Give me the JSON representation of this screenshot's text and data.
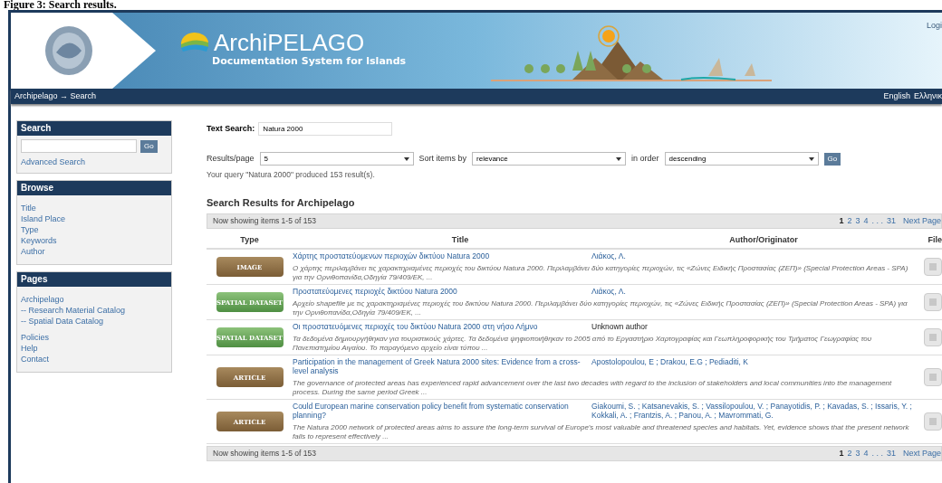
{
  "caption": "Figure 3: Search results.",
  "header": {
    "logo_title": "ArchiPELAGO",
    "subtitle": "Documentation System for Islands",
    "login": "Logi"
  },
  "breadcrumb": "Archipelago → Search",
  "languages": [
    "English",
    "Ελληνικ"
  ],
  "sidebar": {
    "search": {
      "title": "Search",
      "go": "Go",
      "link": "Advanced Search"
    },
    "browse": {
      "title": "Browse",
      "items": [
        "Title",
        "Island Place",
        "Type",
        "Keywords",
        "Author"
      ]
    },
    "pages": {
      "title": "Pages",
      "groups": [
        [
          "Archipelago",
          "-- Research Material Catalog",
          "-- Spatial Data Catalog"
        ],
        [
          "Policies",
          "Help",
          "Contact"
        ]
      ]
    }
  },
  "text_search": {
    "label": "Text Search:",
    "value": "Natura 2000"
  },
  "controls": [
    {
      "label": "Results/page",
      "value": "5"
    },
    {
      "label": "Sort items by",
      "value": "relevance"
    },
    {
      "label": "in order",
      "value": "descending"
    }
  ],
  "go": "Go",
  "summary": "Your query \"Natura 2000\" produced 153 result(s).",
  "heading": "Search Results for Archipelago",
  "pager_top": {
    "text": "Now showing items 1-5 of 153",
    "pages": [
      {
        "label": "1",
        "selected": true
      },
      {
        "label": "2",
        "selected": false
      },
      {
        "label": "3",
        "selected": false
      },
      {
        "label": "4",
        "selected": false
      },
      {
        "label": ". . .",
        "selected": false
      },
      {
        "label": "31",
        "selected": false
      }
    ],
    "next": "Next Page"
  },
  "columns": [
    "Type",
    "Title",
    "Author/Originator",
    "File"
  ],
  "rows": [
    {
      "kind": "image",
      "badge": "IMAGE",
      "title": "Χάρτης προστατεύομενων περιοχών δικτύου Natura 2000",
      "author": "Λιάκος, Λ.",
      "author_link": true,
      "description": "Ο χάρτης περιλαμβάνει τις χαρακτηρισμένες περιοχές του δικτύου Natura 2000. Περιλαμβάνει δύο κατηγορίες περιοχών, τις «Ζώνες Ειδικής Προστασίας (ΖΕΠ)» (Special Protection Areas - SPA) για την Ορνιθοπανίδα,Οδηγία 79/409/ΕΚ, ..."
    },
    {
      "kind": "dataset",
      "badge": "SPATIAL DATASET",
      "title": "Προστατεύομενες περιοχές δικτύου Natura 2000",
      "author": "Λιάκος, Λ.",
      "author_link": true,
      "description": "Αρχείο shapefile με τις χαρακτηρισμένες περιοχές του δικτύου Natura 2000. Περιλαμβάνει δύο κατηγορίες περιοχών, τις «Ζώνες Ειδικής Προστασίας (ΖΕΠ)» (Special Protection Areas - SPA) για την Ορνιθοπανίδα,Οδηγία 79/409/ΕΚ, ..."
    },
    {
      "kind": "dataset",
      "badge": "SPATIAL DATASET",
      "title": "Οι προστατευόμενες περιοχές του δικτύου Natura 2000 στη νήσο Λήμνο",
      "author": "Unknown author",
      "author_link": false,
      "description": "Τα δεδομένα δημιουργήθηκαν για τουριστικούς χάρτες. Τα δεδομένα ψηφιοποιήθηκαν το 2005 από το Εργαστήριο Χαρτογραφίας και Γεωπληροφορικής του Τμήματος Γεωγραφίας του Πανεπιστημίου Αιγαίου. Το παραγόμενο αρχείο είναι τύπου ..."
    },
    {
      "kind": "article",
      "badge": "ARTICLE",
      "title": "Participation in the management of Greek Natura 2000 sites: Evidence from a cross-level analysis",
      "author": "Apostolopoulou, E ; Drakou, E.G ; Pediaditi, K",
      "author_link": true,
      "description": "The governance of protected areas has experienced rapid advancement over the last two decades with regard to the inclusion of stakeholders and local communities into the management process. During the same period Greek ..."
    },
    {
      "kind": "article",
      "badge": "ARTICLE",
      "title": "Could European marine conservation policy benefit from systematic conservation planning?",
      "author": "Giakoumi, S. ; Katsanevakis, S. ; Vassilopoulou, V. ; Panayotidis, P. ; Kavadas, S. ; Issaris, Y. ; Kokkali, A. ; Frantzis, A. ; Panou, A. ; Mavrommati, G.",
      "author_link": true,
      "description": "The Natura 2000 network of protected areas aims to assure the long-term survival of Europe's most valuable and threatened species and habitats. Yet, evidence shows that the present network fails to represent effectively ..."
    }
  ],
  "pager_bottom": {
    "text": "Now showing items 1-5 of 153",
    "pages": [
      {
        "label": "1",
        "selected": true
      },
      {
        "label": "2",
        "selected": false
      },
      {
        "label": "3",
        "selected": false
      },
      {
        "label": "4",
        "selected": false
      },
      {
        "label": ". . .",
        "selected": false
      },
      {
        "label": "31",
        "selected": false
      }
    ],
    "next": "Next Page"
  }
}
